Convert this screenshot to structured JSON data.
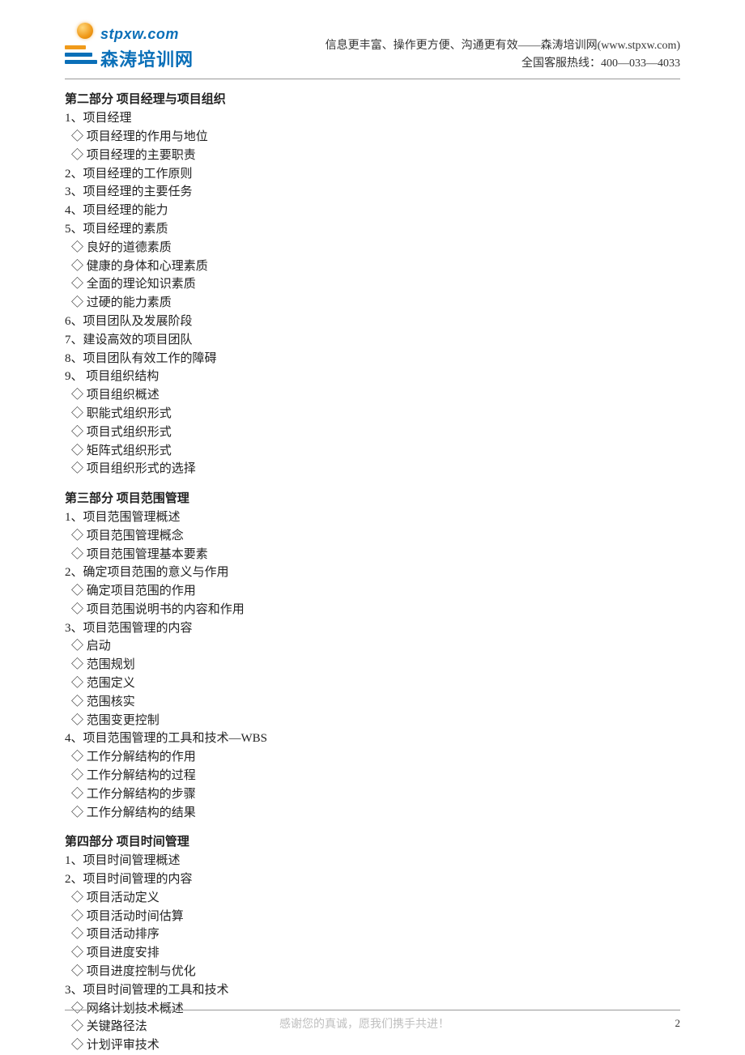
{
  "header": {
    "logo_url": "stpxw.com",
    "logo_cn": "森涛培训网",
    "tagline": "信息更丰富、操作更方便、沟通更有效——森涛培训网(www.stpxw.com)",
    "hotline": "全国客服热线：400—033—4033"
  },
  "sections": [
    {
      "title": "第二部分   项目经理与项目组织",
      "items": [
        {
          "text": "1、项目经理"
        },
        {
          "text": "◇ 项目经理的作用与地位",
          "sub": true
        },
        {
          "text": "◇ 项目经理的主要职责",
          "sub": true
        },
        {
          "text": "2、项目经理的工作原则"
        },
        {
          "text": "3、项目经理的主要任务"
        },
        {
          "text": "4、项目经理的能力"
        },
        {
          "text": "5、项目经理的素质"
        },
        {
          "text": "◇ 良好的道德素质",
          "sub": true
        },
        {
          "text": "◇ 健康的身体和心理素质",
          "sub": true
        },
        {
          "text": "◇ 全面的理论知识素质",
          "sub": true
        },
        {
          "text": "◇ 过硬的能力素质",
          "sub": true
        },
        {
          "text": "6、项目团队及发展阶段"
        },
        {
          "text": "7、建设高效的项目团队"
        },
        {
          "text": "8、项目团队有效工作的障碍"
        },
        {
          "text": "9、 项目组织结构"
        },
        {
          "text": "◇ 项目组织概述",
          "sub": true
        },
        {
          "text": "◇ 职能式组织形式",
          "sub": true
        },
        {
          "text": "◇ 项目式组织形式",
          "sub": true
        },
        {
          "text": "◇ 矩阵式组织形式",
          "sub": true
        },
        {
          "text": "◇ 项目组织形式的选择",
          "sub": true
        }
      ]
    },
    {
      "title": "第三部分   项目范围管理",
      "items": [
        {
          "text": "1、项目范围管理概述"
        },
        {
          "text": "◇ 项目范围管理概念",
          "sub": true
        },
        {
          "text": "◇ 项目范围管理基本要素",
          "sub": true
        },
        {
          "text": "2、确定项目范围的意义与作用"
        },
        {
          "text": "◇ 确定项目范围的作用",
          "sub": true
        },
        {
          "text": "◇ 项目范围说明书的内容和作用",
          "sub": true
        },
        {
          "text": "3、项目范围管理的内容"
        },
        {
          "text": "◇ 启动",
          "sub": true
        },
        {
          "text": "◇ 范围规划",
          "sub": true
        },
        {
          "text": "◇ 范围定义",
          "sub": true
        },
        {
          "text": "◇ 范围核实",
          "sub": true
        },
        {
          "text": "◇ 范围变更控制",
          "sub": true
        },
        {
          "text": "4、项目范围管理的工具和技术—WBS"
        },
        {
          "text": "◇ 工作分解结构的作用",
          "sub": true
        },
        {
          "text": "◇ 工作分解结构的过程",
          "sub": true
        },
        {
          "text": "◇ 工作分解结构的步骤",
          "sub": true
        },
        {
          "text": "◇ 工作分解结构的结果",
          "sub": true
        }
      ]
    },
    {
      "title": "第四部分   项目时间管理",
      "items": [
        {
          "text": "1、项目时间管理概述"
        },
        {
          "text": "2、项目时间管理的内容"
        },
        {
          "text": "◇ 项目活动定义",
          "sub": true
        },
        {
          "text": "◇ 项目活动时间估算",
          "sub": true
        },
        {
          "text": "◇ 项目活动排序",
          "sub": true
        },
        {
          "text": "◇ 项目进度安排",
          "sub": true
        },
        {
          "text": "◇ 项目进度控制与优化",
          "sub": true
        },
        {
          "text": "3、项目时间管理的工具和技术"
        },
        {
          "text": "◇ 网络计划技术概述",
          "sub": true
        },
        {
          "text": "◇ 关键路径法",
          "sub": true
        },
        {
          "text": "◇ 计划评审技术",
          "sub": true
        }
      ]
    }
  ],
  "footer": {
    "slogan": "感谢您的真诚，愿我们携手共进！",
    "page": "2"
  }
}
